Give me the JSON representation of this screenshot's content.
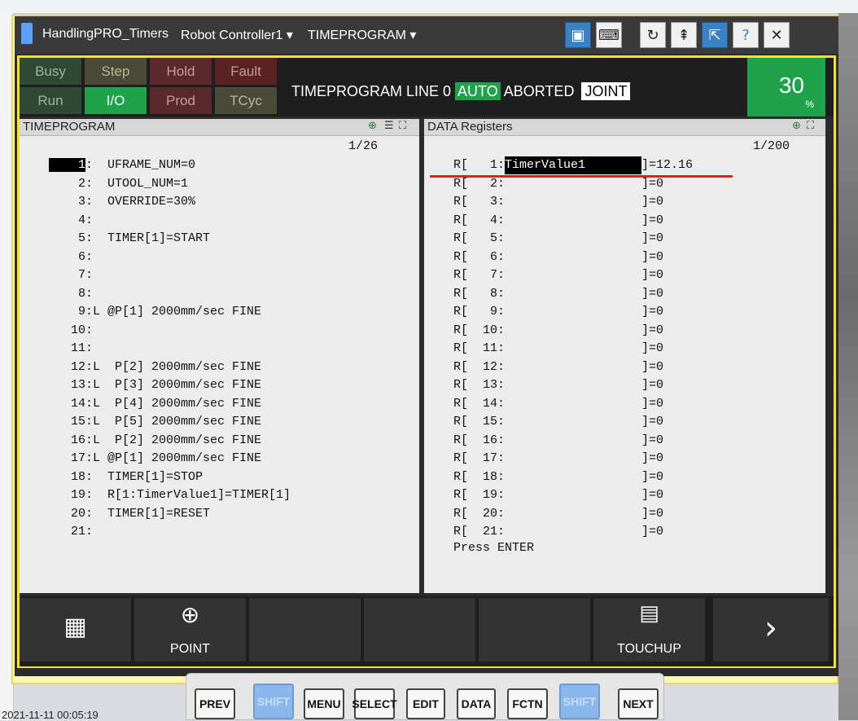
{
  "window": {
    "app_title": "HandlingPRO_Timers",
    "controller": "Robot Controller1",
    "program_menu": "TIMEPROGRAM"
  },
  "status": {
    "busy": "Busy",
    "step": "Step",
    "hold": "Hold",
    "fault": "Fault",
    "run": "Run",
    "io": "I/O",
    "prod": "Prod",
    "tcyc": "TCyc",
    "line_prefix": "TIMEPROGRAM LINE 0",
    "mode_auto": "AUTO",
    "state": "ABORTED",
    "coord": "JOINT",
    "override_value": "30",
    "override_unit": "%",
    "colors": {
      "io_active": "#1fa34a",
      "override_bg": "#1fa34a"
    }
  },
  "program_pane": {
    "title": "TIMEPROGRAM",
    "position": "1/26",
    "lines": [
      "    1:  UFRAME_NUM=0",
      "    2:  UTOOL_NUM=1",
      "    3:  OVERRIDE=30%",
      "    4:",
      "    5:  TIMER[1]=START",
      "    6:",
      "    7:",
      "    8:",
      "    9:L @P[1] 2000mm/sec FINE",
      "   10:",
      "   11:",
      "   12:L  P[2] 2000mm/sec FINE",
      "   13:L  P[3] 2000mm/sec FINE",
      "   14:L  P[4] 2000mm/sec FINE",
      "   15:L  P[5] 2000mm/sec FINE",
      "   16:L  P[2] 2000mm/sec FINE",
      "   17:L @P[1] 2000mm/sec FINE",
      "   18:  TIMER[1]=STOP",
      "   19:  R[1:TimerValue1]=TIMER[1]",
      "   20:  TIMER[1]=RESET",
      "   21:"
    ],
    "cursor_line": "1"
  },
  "data_pane": {
    "title": "DATA Registers",
    "position": "1/200",
    "first_reg_prefix": "R[   1:",
    "first_reg_name": "TimerValue1",
    "first_reg_value": "]=12.16",
    "rows": [
      {
        "reg": "R[   2:",
        "val": "]=0"
      },
      {
        "reg": "R[   3:",
        "val": "]=0"
      },
      {
        "reg": "R[   4:",
        "val": "]=0"
      },
      {
        "reg": "R[   5:",
        "val": "]=0"
      },
      {
        "reg": "R[   6:",
        "val": "]=0"
      },
      {
        "reg": "R[   7:",
        "val": "]=0"
      },
      {
        "reg": "R[   8:",
        "val": "]=0"
      },
      {
        "reg": "R[   9:",
        "val": "]=0"
      },
      {
        "reg": "R[  10:",
        "val": "]=0"
      },
      {
        "reg": "R[  11:",
        "val": "]=0"
      },
      {
        "reg": "R[  12:",
        "val": "]=0"
      },
      {
        "reg": "R[  13:",
        "val": "]=0"
      },
      {
        "reg": "R[  14:",
        "val": "]=0"
      },
      {
        "reg": "R[  15:",
        "val": "]=0"
      },
      {
        "reg": "R[  16:",
        "val": "]=0"
      },
      {
        "reg": "R[  17:",
        "val": "]=0"
      },
      {
        "reg": "R[  18:",
        "val": "]=0"
      },
      {
        "reg": "R[  19:",
        "val": "]=0"
      },
      {
        "reg": "R[  20:",
        "val": "]=0"
      },
      {
        "reg": "R[  21:",
        "val": "]=0"
      }
    ],
    "prompt": "Press ENTER"
  },
  "function_keys": {
    "point": "POINT",
    "touchup": "TOUCHUP"
  },
  "keypad": {
    "prev": "PREV",
    "shift": "SHIFT",
    "menu": "MENU",
    "select": "SELECT",
    "edit": "EDIT",
    "data": "DATA",
    "fctn": "FCTN",
    "next": "NEXT"
  },
  "desktop": {
    "timestamp": "2021-11-11 00:05:19"
  }
}
